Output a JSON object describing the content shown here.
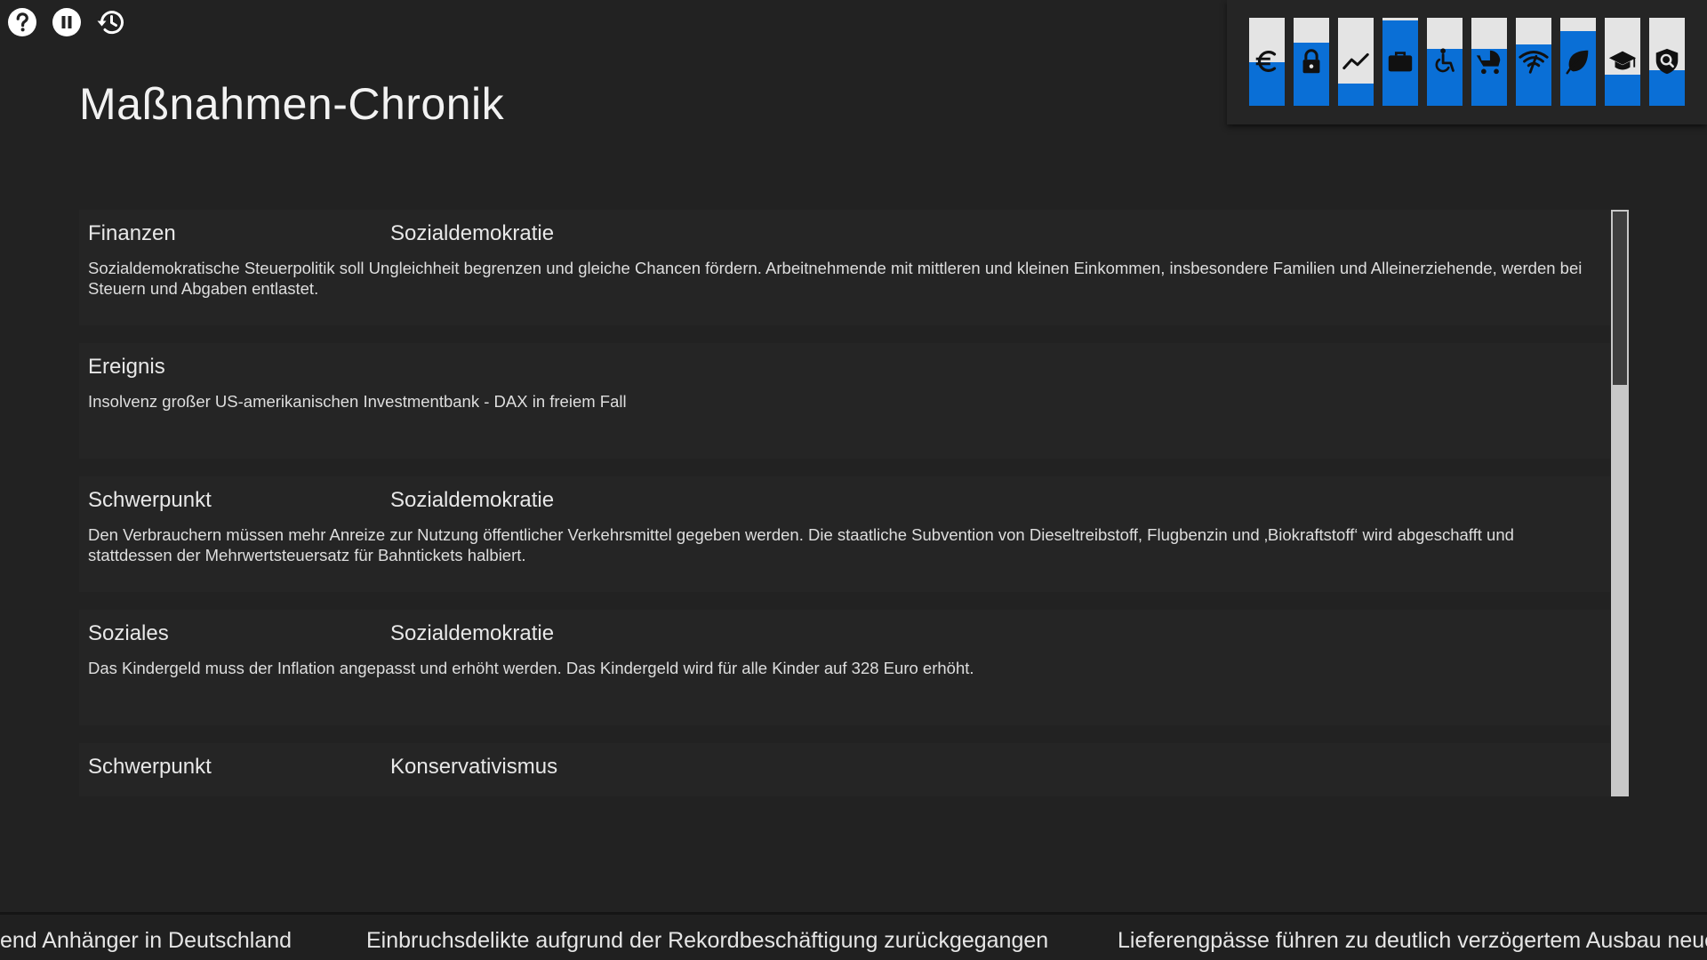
{
  "title": "Maßnahmen-Chronik",
  "controls": [
    {
      "icon": "help-icon"
    },
    {
      "icon": "pause-icon"
    },
    {
      "icon": "history-icon"
    }
  ],
  "indicators": [
    {
      "icon": "euro-icon",
      "level": 0.5
    },
    {
      "icon": "lock-icon",
      "level": 0.72
    },
    {
      "icon": "trend-line-icon",
      "level": 0.25
    },
    {
      "icon": "briefcase-icon",
      "level": 0.97
    },
    {
      "icon": "wheelchair-icon",
      "level": 0.65
    },
    {
      "icon": "baby-carriage-icon",
      "level": 0.65
    },
    {
      "icon": "wifi-icon",
      "level": 0.7
    },
    {
      "icon": "leaf-icon",
      "level": 0.85
    },
    {
      "icon": "graduation-cap-icon",
      "level": 0.35
    },
    {
      "icon": "security-shield-icon",
      "level": 0.4
    }
  ],
  "entries": [
    {
      "category": "Finanzen",
      "party": "Sozialdemokratie",
      "description": "Sozialdemokratische Steuerpolitik soll Ungleichheit begrenzen und gleiche Chancen fördern. Arbeitnehmende mit mittleren und kleinen Einkommen, insbesondere Familien und Alleinerziehende, werden bei Steuern und Abgaben entlastet."
    },
    {
      "category": "Ereignis",
      "party": "",
      "description": "Insolvenz großer US-amerikanischen Investmentbank - DAX in freiem Fall"
    },
    {
      "category": "Schwerpunkt",
      "party": "Sozialdemokratie",
      "description": "Den Verbrauchern müssen mehr Anreize zur Nutzung öffentlicher Verkehrsmittel gegeben werden. Die staatliche Subvention von Dieseltreibstoff, Flugbenzin und ‚Biokraftstoff‘ wird abgeschafft und stattdessen der Mehrwertsteuersatz für Bahntickets halbiert."
    },
    {
      "category": "Soziales",
      "party": "Sozialdemokratie",
      "description": "Das Kindergeld muss der Inflation angepasst und erhöht werden. Das Kindergeld wird für alle Kinder auf 328 Euro erhöht."
    },
    {
      "category": "Schwerpunkt",
      "party": "Konservativismus",
      "description": ""
    }
  ],
  "scroll": {
    "position": 0.0
  },
  "ticker": [
    "end Anhänger in Deutschland",
    "Einbruchsdelikte aufgrund der Rekordbeschäftigung zurückgegangen",
    "Lieferengpässe führen zu deutlich verzögertem Ausbau neue"
  ]
}
